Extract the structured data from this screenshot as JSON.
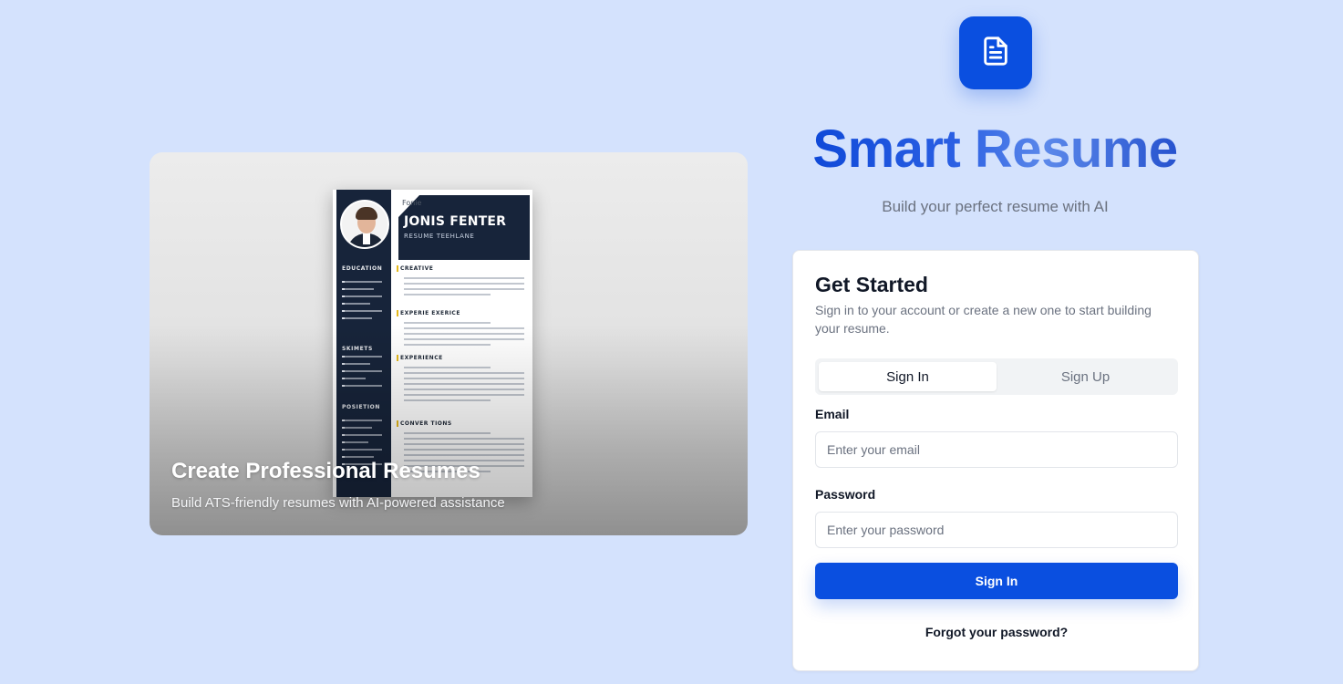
{
  "hero": {
    "title": "Create Professional Resumes",
    "subtitle": "Build ATS-friendly resumes with AI-powered assistance",
    "resume_preview": {
      "small_label": "Fonie",
      "name": "JONIS FENTER",
      "role": "RESUME TEEHLANE",
      "side_headings": [
        "EDUCATION",
        "SKIMETS",
        "POSIETION"
      ],
      "main_headings": [
        "CREATIVE",
        "EXPERIE EXERICE",
        "EXPERIENCE",
        "CONVER TIONS"
      ]
    }
  },
  "brand": {
    "logo_icon": "document-icon",
    "name": "Smart Resume",
    "tagline": "Build your perfect resume with AI",
    "accent_color": "#0a4fe0"
  },
  "auth": {
    "title": "Get Started",
    "description": "Sign in to your account or create a new one to start building your resume.",
    "tabs": [
      {
        "label": "Sign In",
        "active": true
      },
      {
        "label": "Sign Up",
        "active": false
      }
    ],
    "email": {
      "label": "Email",
      "placeholder": "Enter your email",
      "value": ""
    },
    "password": {
      "label": "Password",
      "placeholder": "Enter your password",
      "value": ""
    },
    "submit_label": "Sign In",
    "forgot_label": "Forgot your password?"
  }
}
